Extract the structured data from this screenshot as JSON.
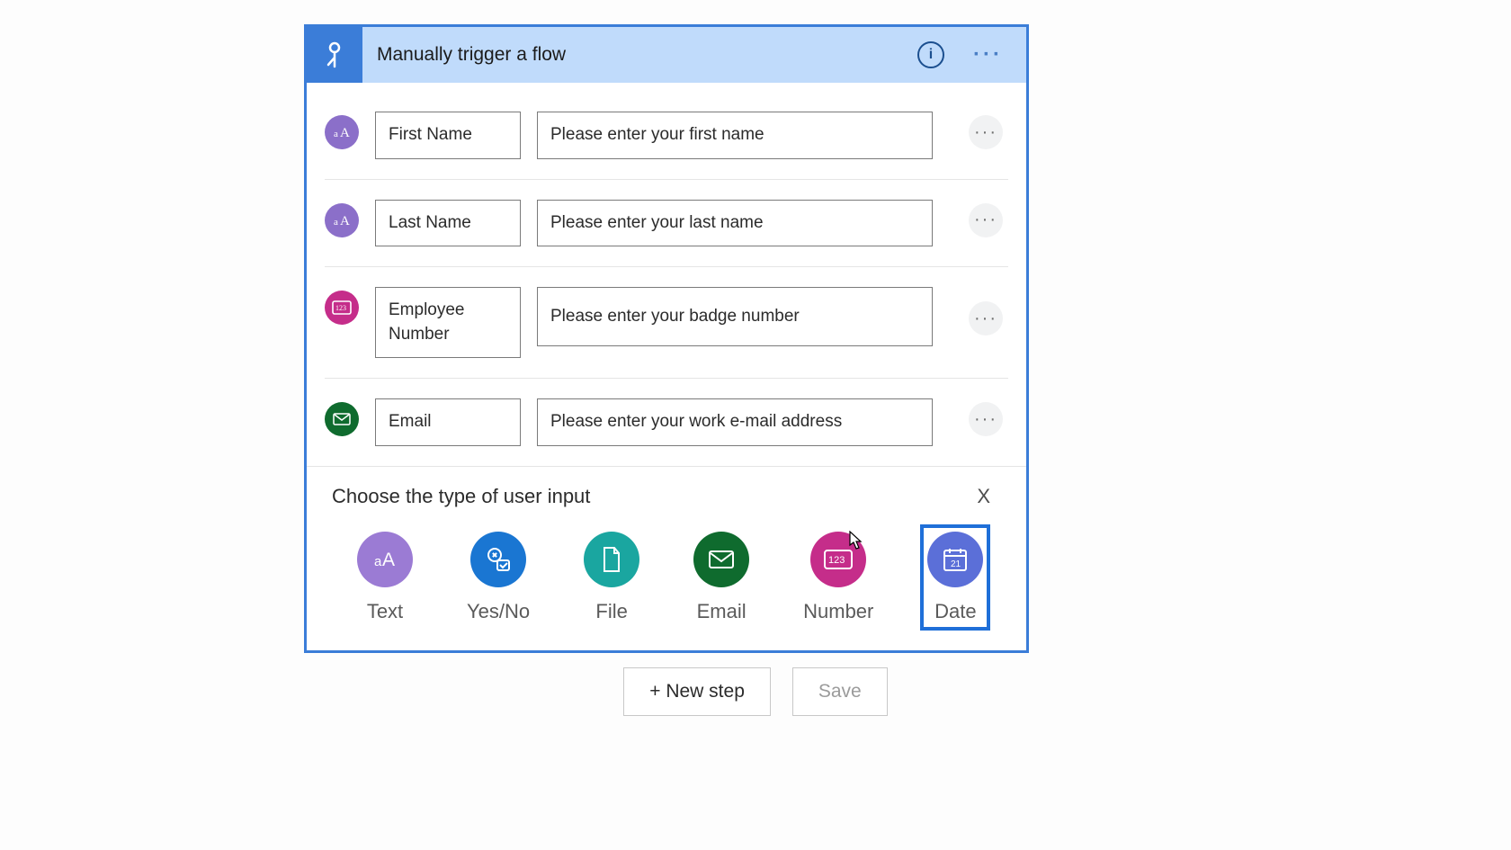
{
  "trigger": {
    "title": "Manually trigger a flow",
    "inputs": [
      {
        "type": "text",
        "name": "First Name",
        "placeholder": "Please enter your first name"
      },
      {
        "type": "text",
        "name": "Last Name",
        "placeholder": "Please enter your last name"
      },
      {
        "type": "number",
        "name": "Employee Number",
        "placeholder": "Please enter your badge number"
      },
      {
        "type": "email",
        "name": "Email",
        "placeholder": "Please enter your work e-mail address"
      }
    ]
  },
  "picker": {
    "title": "Choose the type of user input",
    "close_label": "X",
    "options": [
      {
        "id": "text",
        "label": "Text"
      },
      {
        "id": "yesno",
        "label": "Yes/No"
      },
      {
        "id": "file",
        "label": "File"
      },
      {
        "id": "email",
        "label": "Email"
      },
      {
        "id": "number",
        "label": "Number"
      },
      {
        "id": "date",
        "label": "Date"
      }
    ],
    "selected": "date"
  },
  "footer": {
    "new_step": "+ New step",
    "save": "Save"
  }
}
